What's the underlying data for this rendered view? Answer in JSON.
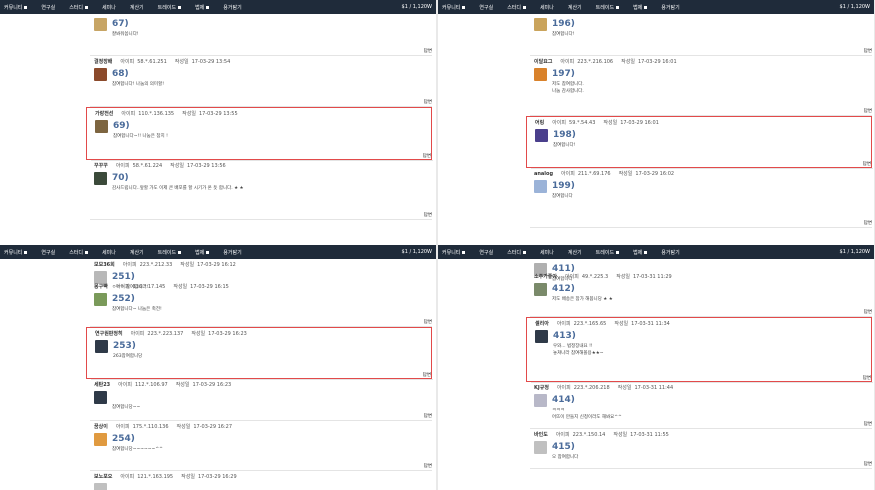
{
  "nav": [
    "커뮤니티",
    "연구실",
    "스터디",
    "세미나",
    "계산기",
    "트레이드",
    "법제",
    "용거탐기"
  ],
  "nav_dropdown": [
    true,
    false,
    true,
    false,
    false,
    true,
    true,
    false
  ],
  "price": "$1 / 1,120W",
  "labels": {
    "ip": "아이피",
    "date": "작성일",
    "reply": "답변"
  },
  "panels": [
    {
      "comments": [
        {
          "nick": "",
          "ip": "",
          "date": "",
          "num": "67)",
          "lines": [
            "잘봐줘씀니다!"
          ],
          "avatar": "#c7a565"
        },
        {
          "nick": "결정장배",
          "ip": "58.*.61.251",
          "date": "17-03-29 13:54",
          "num": "68)",
          "lines": [
            "참여합니다! 나눔의 의미할!"
          ],
          "avatar": "#8b4a2b"
        },
        {
          "nick": "가랑전선",
          "ip": "110.*.136.135",
          "date": "17-03-29 13:55",
          "num": "69)",
          "lines": [
            "참여합니다~!! 나눔은 참치 !"
          ],
          "avatar": "#7d6540",
          "highlight": true
        },
        {
          "nick": "꾸꾸꾸",
          "ip": "58.*.61.224",
          "date": "17-03-29 13:56",
          "num": "70)",
          "lines": [
            "감사드립니다..앞할 가도 이제 큰 배포를 할 시기가 온 듯 합니다. ★ ★"
          ],
          "avatar": "#3b4a3a"
        }
      ]
    },
    {
      "comments": [
        {
          "nick": "",
          "ip": "",
          "date": "",
          "num": "196)",
          "lines": [
            "참여합니다!"
          ],
          "avatar": "#caa45c"
        },
        {
          "nick": "이달요그",
          "ip": "223.*.216.106",
          "date": "17-03-29 16:01",
          "num": "197)",
          "lines": [
            "저도 참여합니다.",
            "나눔 감사합니다."
          ],
          "avatar": "#d9822b"
        },
        {
          "nick": "어링",
          "ip": "59.*.54.43",
          "date": "17-03-29 16:01",
          "num": "198)",
          "lines": [
            "참여합니다!"
          ],
          "avatar": "#4a3f8c",
          "highlight": true
        },
        {
          "nick": "analog",
          "ip": "211.*.69.176",
          "date": "17-03-29 16:02",
          "num": "199)",
          "lines": [
            "참여합니다"
          ],
          "avatar": "#9bb3d8"
        }
      ]
    },
    {
      "comments": [
        {
          "nick": "모모36회",
          "ip": "223.*.212.33",
          "date": "17-03-29 16:12",
          "num": "251)",
          "lines": [
            "ㅇㅇㅇ 참여합니다!"
          ],
          "avatar": "#b8b8b8"
        },
        {
          "nick": "몽구빡",
          "ip": "116.*.17.145",
          "date": "17-03-29 16:15",
          "num": "252)",
          "lines": [
            "참여합니다~ 나눔은 축전!"
          ],
          "avatar": "#7a9a5a"
        },
        {
          "nick": "연구원판정히",
          "ip": "223.*.223.137",
          "date": "17-03-29 16:23",
          "num": "253)",
          "lines": [
            "263참여합니당"
          ],
          "avatar": "#2f3a48",
          "highlight": true
        },
        {
          "nick": "세탄23",
          "ip": "112.*.106.97",
          "date": "17-03-29 16:23",
          "num": "",
          "lines": [
            "참여합니당~~"
          ],
          "avatar": "#2f3a48"
        },
        {
          "nick": "꿈상이",
          "ip": "175.*.110.136",
          "date": "17-03-29 16:27",
          "num": "254)",
          "lines": [
            "참여합니당~~~~~~^^"
          ],
          "avatar": "#e09a40"
        },
        {
          "nick": "보노포오",
          "ip": "121.*.163.195",
          "date": "17-03-29 16:29",
          "num": "",
          "lines": [],
          "avatar": "#c0c0c0"
        }
      ]
    },
    {
      "comments": [
        {
          "nick": "",
          "ip": "",
          "date": "",
          "num": "411)",
          "lines": [
            "참여합니다"
          ],
          "avatar": "#b0b0b0"
        },
        {
          "nick": "소주가좋아",
          "ip": "49.*.225.3",
          "date": "17-03-31 11:29",
          "num": "412)",
          "lines": [
            "저도 배송은 참가 해봅니당 ★ ★"
          ],
          "avatar": "#7a8a6a"
        },
        {
          "nick": "셀리아",
          "ip": "223.*.165.65",
          "date": "17-03-31 11:34",
          "num": "413)",
          "lines": [
            "우와... 법정장내요 !!",
            "놓쳐나라 참여해볼용★★~"
          ],
          "avatar": "#2f3a48",
          "highlight": true
        },
        {
          "nick": "KJ규정",
          "ip": "223.*.206.218",
          "date": "17-03-31 11:44",
          "num": "414)",
          "lines": [
            "ㅋㅋㅋ",
            "어뜨이 만들지 신청이라도 해봐요^^"
          ],
          "avatar": "#b8b8c8"
        },
        {
          "nick": "바인도",
          "ip": "223.*.150.14",
          "date": "17-03-31 11:55",
          "num": "415)",
          "lines": [
            "오 참여합니다"
          ],
          "avatar": "#c0c0c0"
        }
      ]
    }
  ]
}
